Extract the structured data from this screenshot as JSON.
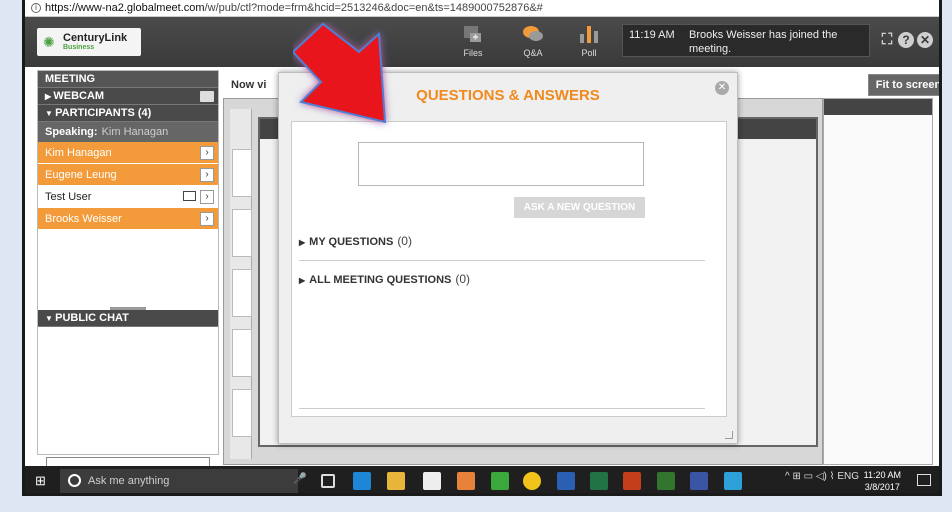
{
  "browser": {
    "url_host": "https://www-na2.globalmeet.com",
    "url_path": "/w/pub/ctl?mode=frm&hcid=2513246&doc=en&ts=1489000752876&#"
  },
  "toolbar": {
    "logo_name": "CenturyLink",
    "logo_sub": "Business",
    "buttons": [
      {
        "label": "Files",
        "icon": "files-icon"
      },
      {
        "label": "Q&A",
        "icon": "qa-chat-icon"
      },
      {
        "label": "Poll",
        "icon": "poll-icon"
      }
    ],
    "notification": {
      "time": "11:19 AM",
      "message": "Brooks Weisser has joined the meeting."
    },
    "icon_help": "?",
    "icon_close": "⊗"
  },
  "sidebar": {
    "meeting_header": "MEETING",
    "webcam_header": "WEBCAM",
    "participants_header": "PARTICIPANTS",
    "participants_count": "(4)",
    "speaking_label": "Speaking:",
    "speaking_name": "Kim Hanagan",
    "participants": [
      {
        "name": "Kim Hanagan",
        "style": "orange"
      },
      {
        "name": "Eugene Leung",
        "style": "orange"
      },
      {
        "name": "Test User",
        "style": "white"
      },
      {
        "name": "Brooks Weisser",
        "style": "orange"
      }
    ],
    "public_chat_header": "PUBLIC CHAT"
  },
  "content": {
    "now_viewing": "Now vi",
    "fit_to_screen": "Fit to screen"
  },
  "qa_dialog": {
    "title": "QUESTIONS & ANSWERS",
    "ask_button": "ASK A NEW QUESTION",
    "my_questions_label": "MY QUESTIONS",
    "my_questions_count": "(0)",
    "all_questions_label": "ALL MEETING QUESTIONS",
    "all_questions_count": "(0)",
    "question_input_value": ""
  },
  "taskbar": {
    "search_placeholder": "Ask me anything",
    "language": "ENG",
    "time": "11:20 AM",
    "date": "3/8/2017"
  },
  "colors": {
    "accent_orange": "#f08a1e",
    "participant_orange": "#f39b3a",
    "arrow_red": "#e8141b"
  }
}
